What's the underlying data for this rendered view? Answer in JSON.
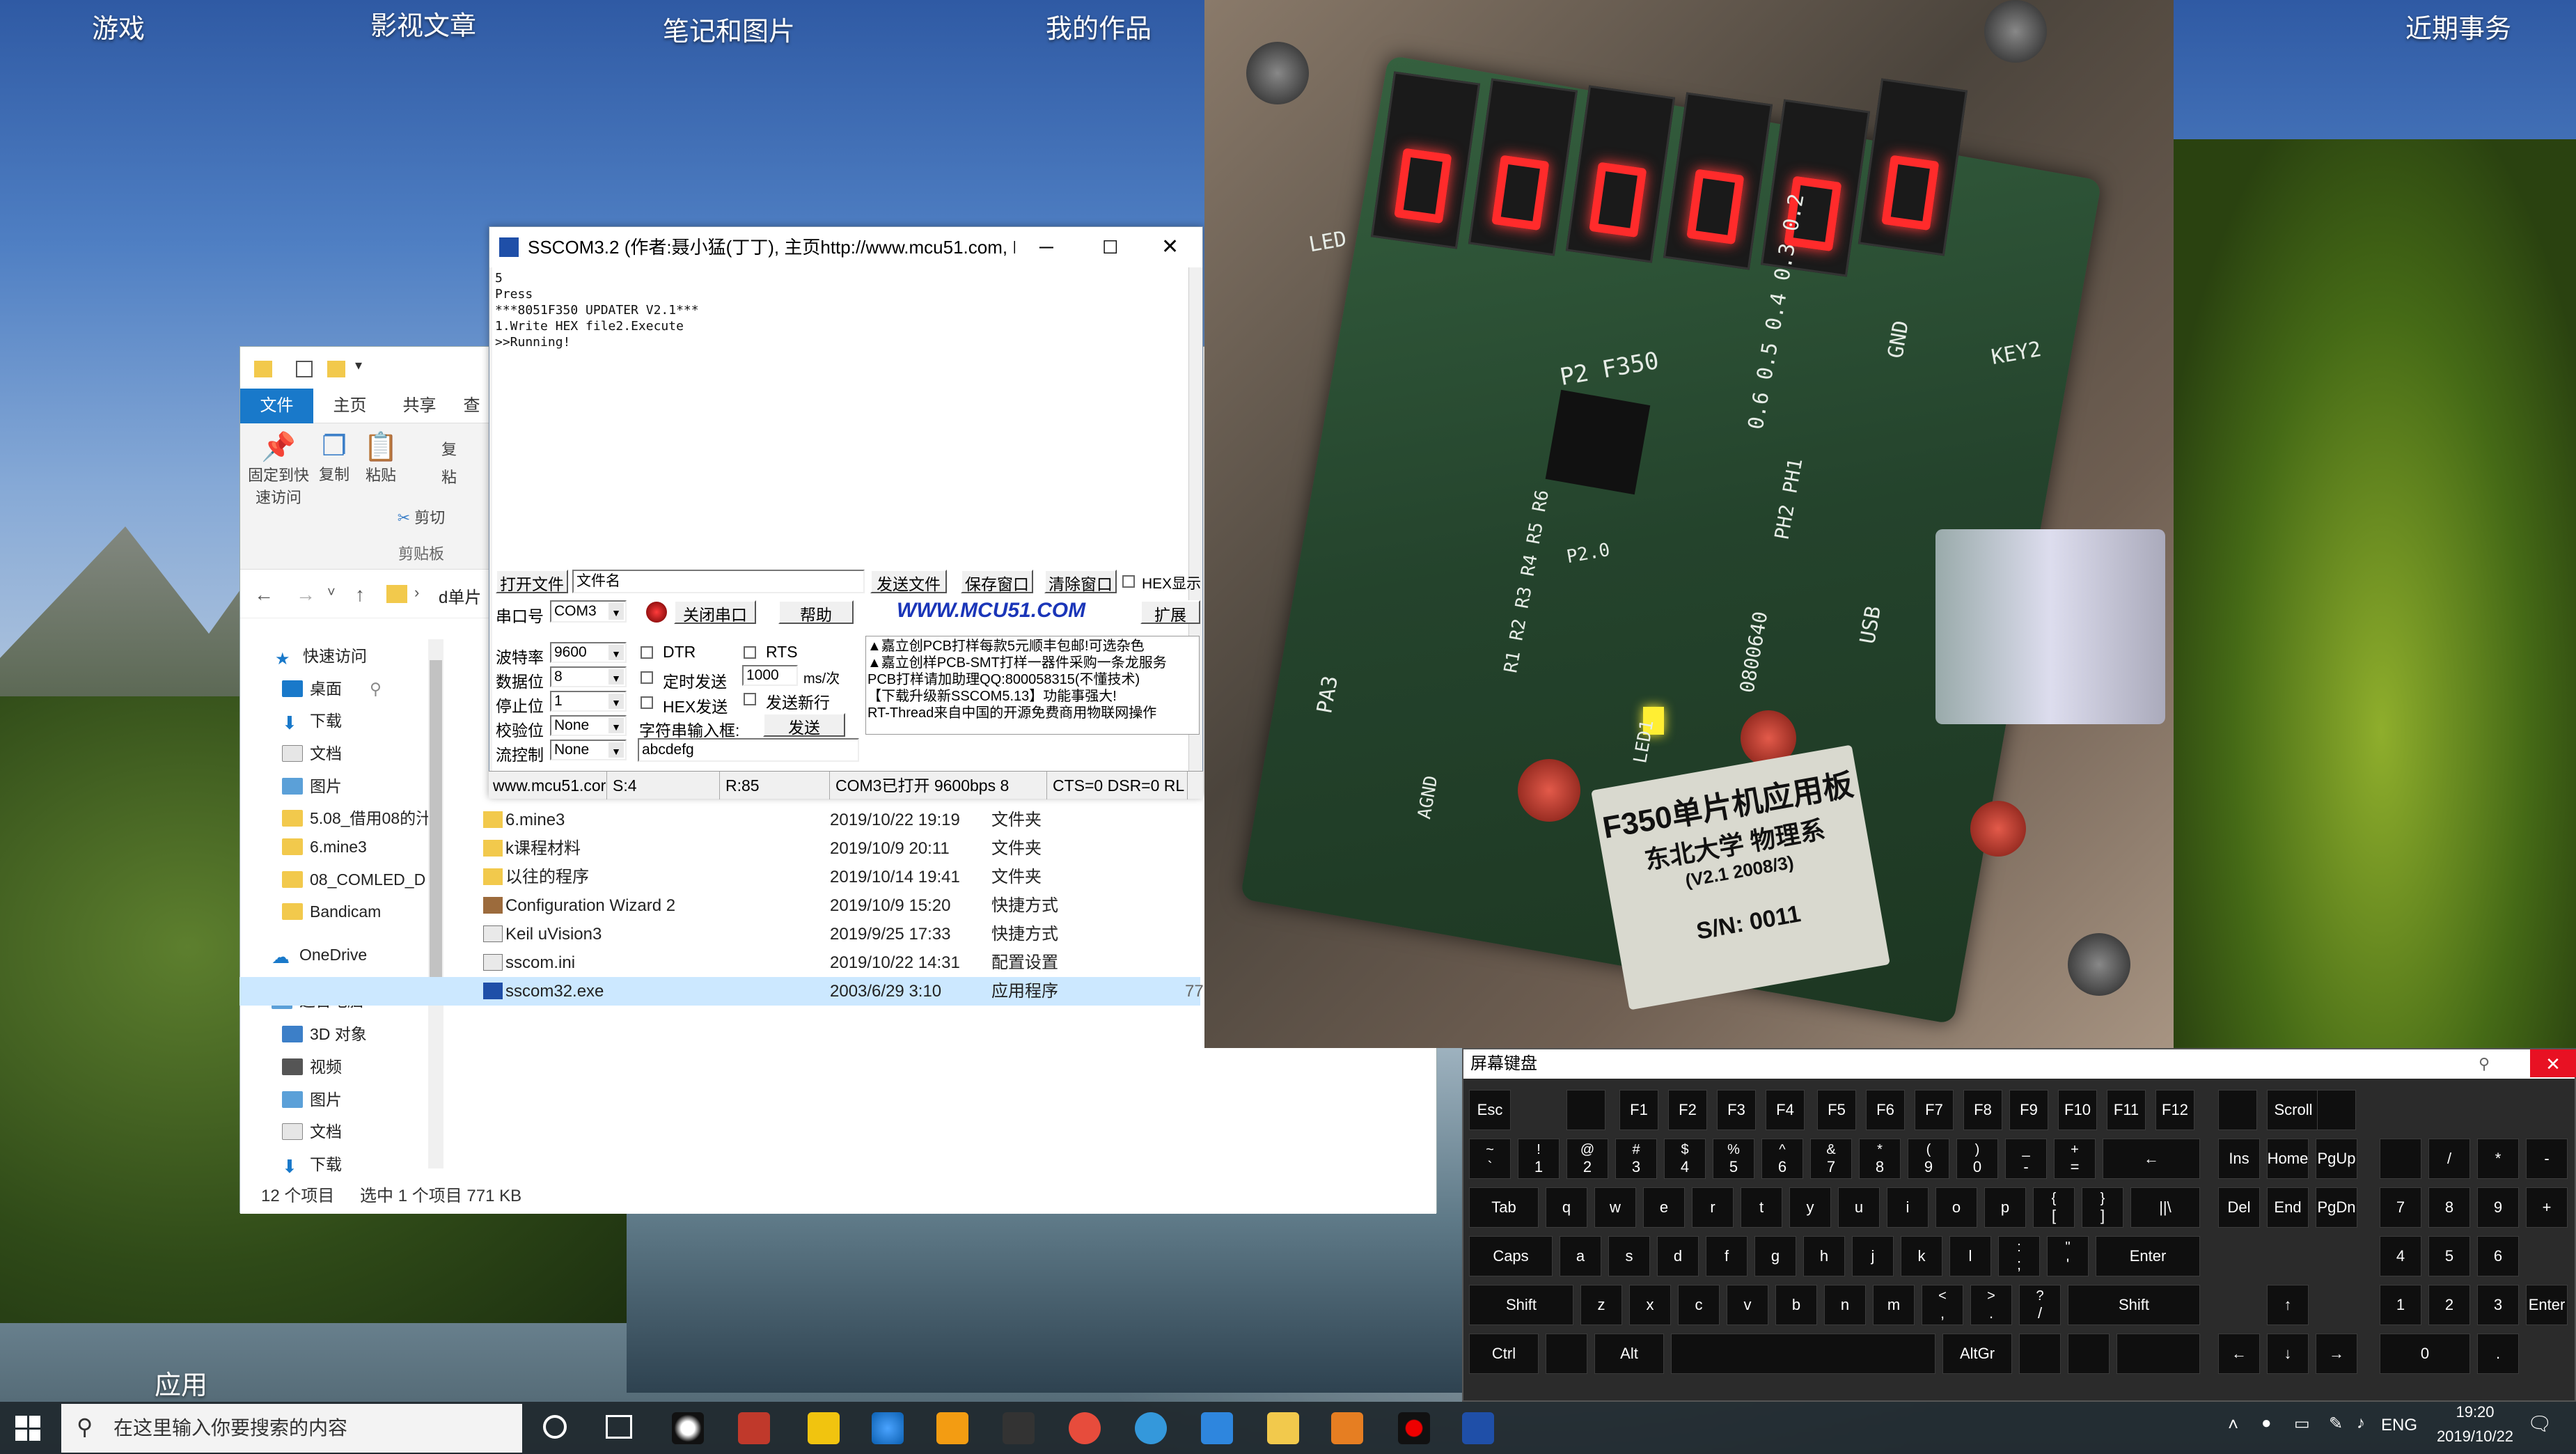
{
  "desktop": {
    "icons": [
      "游戏",
      "影视文章",
      "笔记和图片",
      "我的作品",
      "近期事务",
      "应用"
    ]
  },
  "explorer": {
    "ribbon_tabs": [
      "文件",
      "主页",
      "共享",
      "查"
    ],
    "ribbon_buttons": {
      "pin": "固定到快\n速访问",
      "copy": "复制",
      "paste": "粘贴",
      "cut": "剪切",
      "clipboard_group": "剪贴板",
      "copy_path": "复",
      "paste_shortcut": "粘"
    },
    "path": "d单片",
    "nav": [
      "快速访问",
      "桌面",
      "下载",
      "文档",
      "图片",
      "5.08_借用08的汁",
      "6.mine3",
      "08_COMLED_D",
      "Bandicam",
      "OneDrive",
      "这台电脑",
      "3D 对象",
      "视频",
      "图片",
      "文档",
      "下载"
    ],
    "files": [
      {
        "name": "6.mine3",
        "date": "2019/10/22 19:19",
        "type": "文件夹",
        "size": ""
      },
      {
        "name": "k课程材料",
        "date": "2019/10/9 20:11",
        "type": "文件夹",
        "size": ""
      },
      {
        "name": "以往的程序",
        "date": "2019/10/14 19:41",
        "type": "文件夹",
        "size": ""
      },
      {
        "name": "Configuration Wizard 2",
        "date": "2019/10/9 15:20",
        "type": "快捷方式",
        "size": ""
      },
      {
        "name": "Keil uVision3",
        "date": "2019/9/25 17:33",
        "type": "快捷方式",
        "size": ""
      },
      {
        "name": "sscom.ini",
        "date": "2019/10/22 14:31",
        "type": "配置设置",
        "size": ""
      },
      {
        "name": "sscom32.exe",
        "date": "2003/6/29 3:10",
        "type": "应用程序",
        "size": "77"
      }
    ],
    "status": {
      "count": "12 个项目",
      "selected": "选中 1 个项目  771 KB"
    }
  },
  "sscom": {
    "title": "SSCOM3.2 (作者:聂小猛(丁丁), 主页http://www.mcu51.com,  E...",
    "terminal": [
      "5",
      "Press",
      "",
      "",
      "***8051F350 UPDATER V2.1***",
      "1.Write HEX file2.Execute",
      ">>Running!"
    ],
    "open_file": "打开文件",
    "file_name": "文件名",
    "send_file": "发送文件",
    "save_window": "保存窗口",
    "clear_window": "清除窗口",
    "hex_display": "HEX显示",
    "port_label": "串口号",
    "port_value": "COM3",
    "close_port": "关闭串口",
    "help": "帮助",
    "website": "WWW.MCU51.COM",
    "expand": "扩展",
    "baud_label": "波特率",
    "baud_value": "9600",
    "data_label": "数据位",
    "data_value": "8",
    "stop_label": "停止位",
    "stop_value": "1",
    "parity_label": "校验位",
    "parity_value": "None",
    "flow_label": "流控制",
    "flow_value": "None",
    "dtr": "DTR",
    "rts": "RTS",
    "timed_send": "定时发送",
    "interval": "1000",
    "interval_unit": "ms/次",
    "hex_send": "HEX发送",
    "send_newline": "发送新行",
    "input_label": "字符串输入框:",
    "send": "发送",
    "input_value": "abcdefg",
    "ads": [
      "▲嘉立创PCB打样每款5元顺丰包邮!可选杂色",
      "▲嘉立创样PCB-SMT打样一器件采购一条龙服务",
      "PCB打样请加助理QQ:800058315(不懂技术)",
      "【下载升级新SSCOM5.13】功能事强大!",
      "RT-Thread来自中国的开源免费商用物联网操作"
    ],
    "status": {
      "site": "www.mcu51.cor",
      "s": "S:4",
      "r": "R:85",
      "port": "COM3已打开  9600bps  8",
      "lines": "CTS=0 DSR=0 RL"
    }
  },
  "photo": {
    "board_label": [
      "F350单片机应用板",
      "东北大学 物理系",
      "(V2.1  2008/3)",
      "S/N:  0011"
    ],
    "silk": [
      "P2 F350",
      "0.6 0.5 0.4 0.3 0.2",
      "PH2 PH1",
      "0800640",
      "USB",
      "GND",
      "AGND",
      "P2.0",
      "LED1",
      "KEY2",
      "R1 R2 R3 R4 R5 R6",
      "PA3",
      "LED"
    ]
  },
  "osk": {
    "title": "屏幕键盘",
    "rows": [
      [
        "Esc",
        "",
        "F1",
        "F2",
        "F3",
        "F4",
        "F5",
        "F6",
        "F7",
        "F8",
        "F9",
        "F10",
        "F11",
        "F12",
        "",
        "Scroll",
        ""
      ],
      [
        "~|`",
        "!|1",
        "@|2",
        "#|3",
        "$|4",
        "%|5",
        "^|6",
        "&|7",
        "*|8",
        "(|9",
        ")|0",
        "_|-",
        "+|=",
        "←",
        "Ins",
        "Home",
        "PgUp",
        "",
        "/",
        "*",
        "-"
      ],
      [
        "Tab",
        "q",
        "w",
        "e",
        "r",
        "t",
        "y",
        "u",
        "i",
        "o",
        "p",
        "{|[",
        "}|]",
        "||\\",
        "Del",
        "End",
        "PgDn",
        "7",
        "8",
        "9",
        "+"
      ],
      [
        "Caps",
        "a",
        "s",
        "d",
        "f",
        "g",
        "h",
        "j",
        "k",
        "l",
        ":|;",
        "\"|'",
        "Enter",
        "4",
        "5",
        "6"
      ],
      [
        "Shift",
        "z",
        "x",
        "c",
        "v",
        "b",
        "n",
        "m",
        "<|,",
        ">|.",
        "?|/",
        "Shift",
        "↑",
        "1",
        "2",
        "3",
        "Enter"
      ],
      [
        "Ctrl",
        "",
        "Alt",
        "",
        "AltGr",
        "",
        "",
        "",
        "←",
        "↓",
        "→",
        "0",
        "."
      ]
    ]
  },
  "taskbar": {
    "search_placeholder": "在这里输入你要搜索的内容",
    "lang": "ENG",
    "time": "19:20",
    "date": "2019/10/22"
  },
  "colors": {
    "accent": "#1979ca",
    "led": "#ff2b2b",
    "taskbar": "#20282e"
  }
}
